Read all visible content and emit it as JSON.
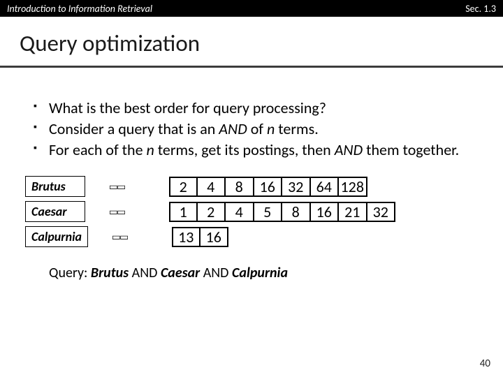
{
  "topbar": {
    "left": "Introduction to Information Retrieval",
    "right": "Sec. 1.3"
  },
  "title": "Query optimization",
  "bullets": [
    "What is the best order for query processing?",
    "Consider a query that is an AND of n terms.",
    "For each of the n terms, get its postings, then AND them together."
  ],
  "postings": [
    {
      "term": "Brutus",
      "ids": [
        2,
        4,
        8,
        16,
        32,
        64,
        128
      ]
    },
    {
      "term": "Caesar",
      "ids": [
        1,
        2,
        4,
        5,
        8,
        16,
        21,
        32
      ]
    },
    {
      "term": "Calpurnia",
      "ids": [
        13,
        16
      ]
    }
  ],
  "query": {
    "label": "Query: ",
    "t1": "Brutus",
    "op1": " AND ",
    "t2": "Caesar",
    "op2": " AND ",
    "t3": "Calpurnia"
  },
  "slidenum": "40"
}
